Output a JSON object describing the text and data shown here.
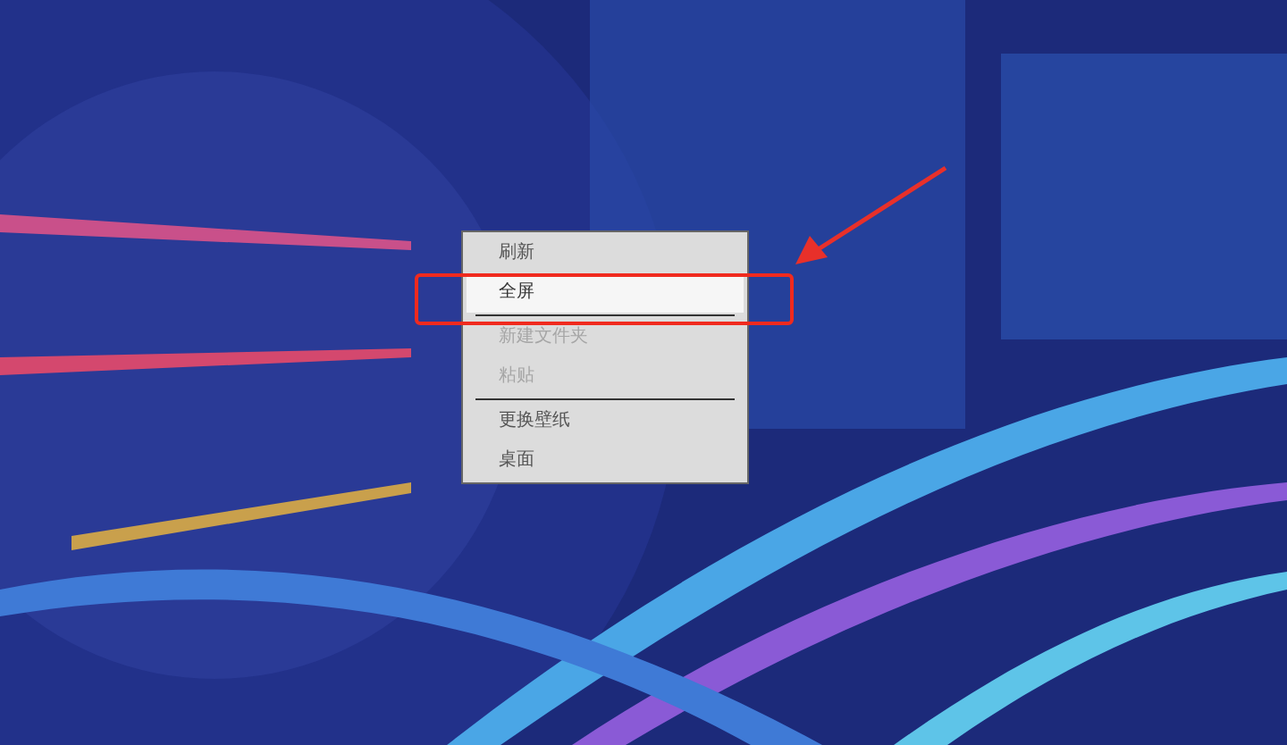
{
  "context_menu": {
    "items": [
      {
        "kind": "item",
        "label": "刷新",
        "selected": false,
        "disabled": false
      },
      {
        "kind": "item",
        "label": "全屏",
        "selected": true,
        "disabled": false
      },
      {
        "kind": "separator"
      },
      {
        "kind": "item",
        "label": "新建文件夹",
        "selected": false,
        "disabled": true
      },
      {
        "kind": "item",
        "label": "粘贴",
        "selected": false,
        "disabled": true
      },
      {
        "kind": "separator"
      },
      {
        "kind": "item",
        "label": "更换壁纸",
        "selected": false,
        "disabled": false
      },
      {
        "kind": "item",
        "label": "桌面",
        "selected": false,
        "disabled": false
      }
    ]
  }
}
